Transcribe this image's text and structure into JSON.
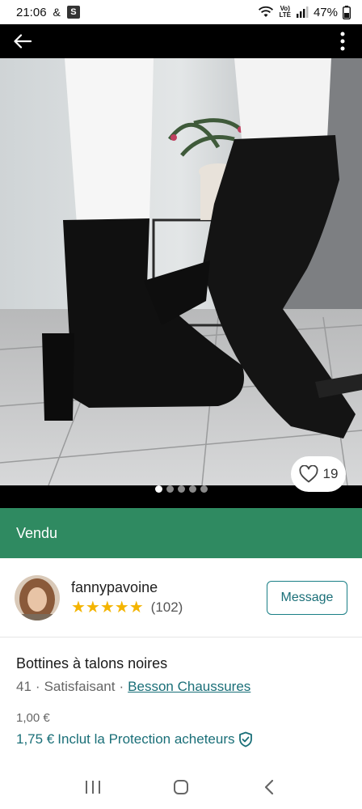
{
  "status_bar": {
    "time": "21:06",
    "amp": "&",
    "s_badge": "S",
    "volte": "Vo)\nLTE",
    "battery": "47%"
  },
  "photo": {
    "likes": "19",
    "dot_count": 5,
    "active_dot": 0
  },
  "status_banner": {
    "label": "Vendu",
    "color": "#2f8a61"
  },
  "seller": {
    "username": "fannypavoine",
    "stars": "★★★★★",
    "rating_count": "(102)",
    "message_label": "Message"
  },
  "item": {
    "title": "Bottines à talons noires",
    "size": "41",
    "sep1": "·",
    "condition": "Satisfaisant",
    "sep2": "·",
    "brand": "Besson Chaussures",
    "price": "1,00 €",
    "total_price": "1,75 €",
    "protection_text": "Inclut la Protection acheteurs"
  },
  "icons": {
    "back": "arrow-left-icon",
    "more": "more-vertical-icon",
    "like": "heart-icon",
    "shield": "shield-check-icon",
    "nav_recent": "recent-apps-icon",
    "nav_home": "home-icon",
    "nav_back": "chevron-left-icon"
  },
  "colors": {
    "accent": "#1a6f78",
    "sold_green": "#2f8a61",
    "star": "#f4b400"
  }
}
